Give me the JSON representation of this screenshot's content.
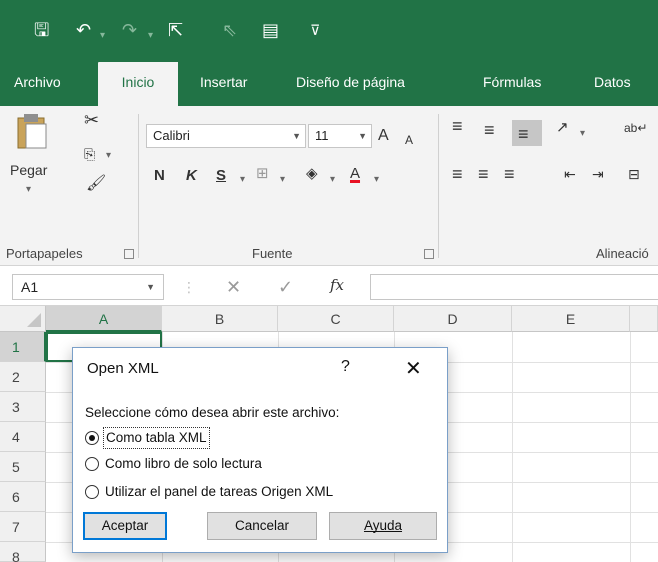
{
  "quick_access": {
    "save_glyph": "🖫",
    "undo_glyph": "↶",
    "redo_glyph": "↷",
    "share_glyph": "⇱",
    "pointer_glyph": "⇖",
    "form_glyph": "▤",
    "customize_glyph": "⊽"
  },
  "tabs": {
    "archivo": "Archivo",
    "inicio": "Inicio",
    "insertar": "Insertar",
    "diseno": "Diseño de página",
    "formulas": "Fórmulas",
    "datos": "Datos"
  },
  "ribbon": {
    "paste_label": "Pegar",
    "clipboard_group": "Portapapeles",
    "font_group": "Fuente",
    "alignment_group": "Alineació",
    "font_name": "Calibri",
    "font_size": "11",
    "grow_font": "A",
    "shrink_font": "A",
    "bold": "N",
    "italic": "K",
    "underline": "S",
    "font_color_glyph": "A"
  },
  "formula_bar": {
    "name_box": "A1",
    "cancel_glyph": "✕",
    "enter_glyph": "✓",
    "fx_label": "fx"
  },
  "grid": {
    "columns": [
      "A",
      "B",
      "C",
      "D",
      "E"
    ],
    "rows": [
      "1",
      "2",
      "3",
      "4",
      "5",
      "6",
      "7",
      "8"
    ],
    "active_cell": "A1"
  },
  "dialog": {
    "title": "Open XML",
    "help": "?",
    "close": "✕",
    "prompt": "Seleccione cómo desea abrir este archivo:",
    "options": [
      {
        "label": "Como tabla XML",
        "selected": true
      },
      {
        "label": "Como libro de solo lectura",
        "selected": false
      },
      {
        "label": "Utilizar el panel de tareas Origen XML",
        "selected": false
      }
    ],
    "accept": "Aceptar",
    "cancel": "Cancelar",
    "help_button": "Ayuda"
  },
  "colors": {
    "excel_green": "#217346",
    "focus_blue": "#0078d7",
    "font_color_red": "#e81123"
  }
}
